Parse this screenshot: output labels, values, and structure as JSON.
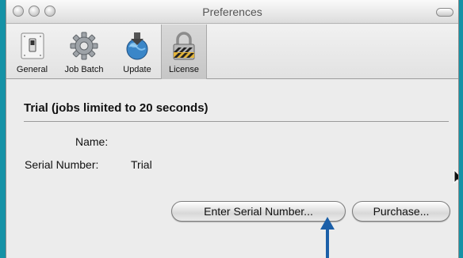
{
  "window": {
    "title": "Preferences"
  },
  "toolbar": {
    "items": [
      {
        "label": "General",
        "icon": "switch-icon"
      },
      {
        "label": "Job Batch",
        "icon": "gear-icon"
      },
      {
        "label": "Update",
        "icon": "globe-download-icon"
      },
      {
        "label": "License",
        "icon": "padlock-icon",
        "selected": true
      }
    ]
  },
  "license": {
    "heading": "Trial (jobs limited to 20 seconds)",
    "name_label": "Name:",
    "name_value": "",
    "serial_label": "Serial Number:",
    "serial_value": "Trial"
  },
  "buttons": {
    "enter_serial": "Enter Serial Number...",
    "purchase": "Purchase..."
  },
  "colors": {
    "desktop_background": "#1592a6",
    "annotation_arrow": "#1b5fa8"
  }
}
